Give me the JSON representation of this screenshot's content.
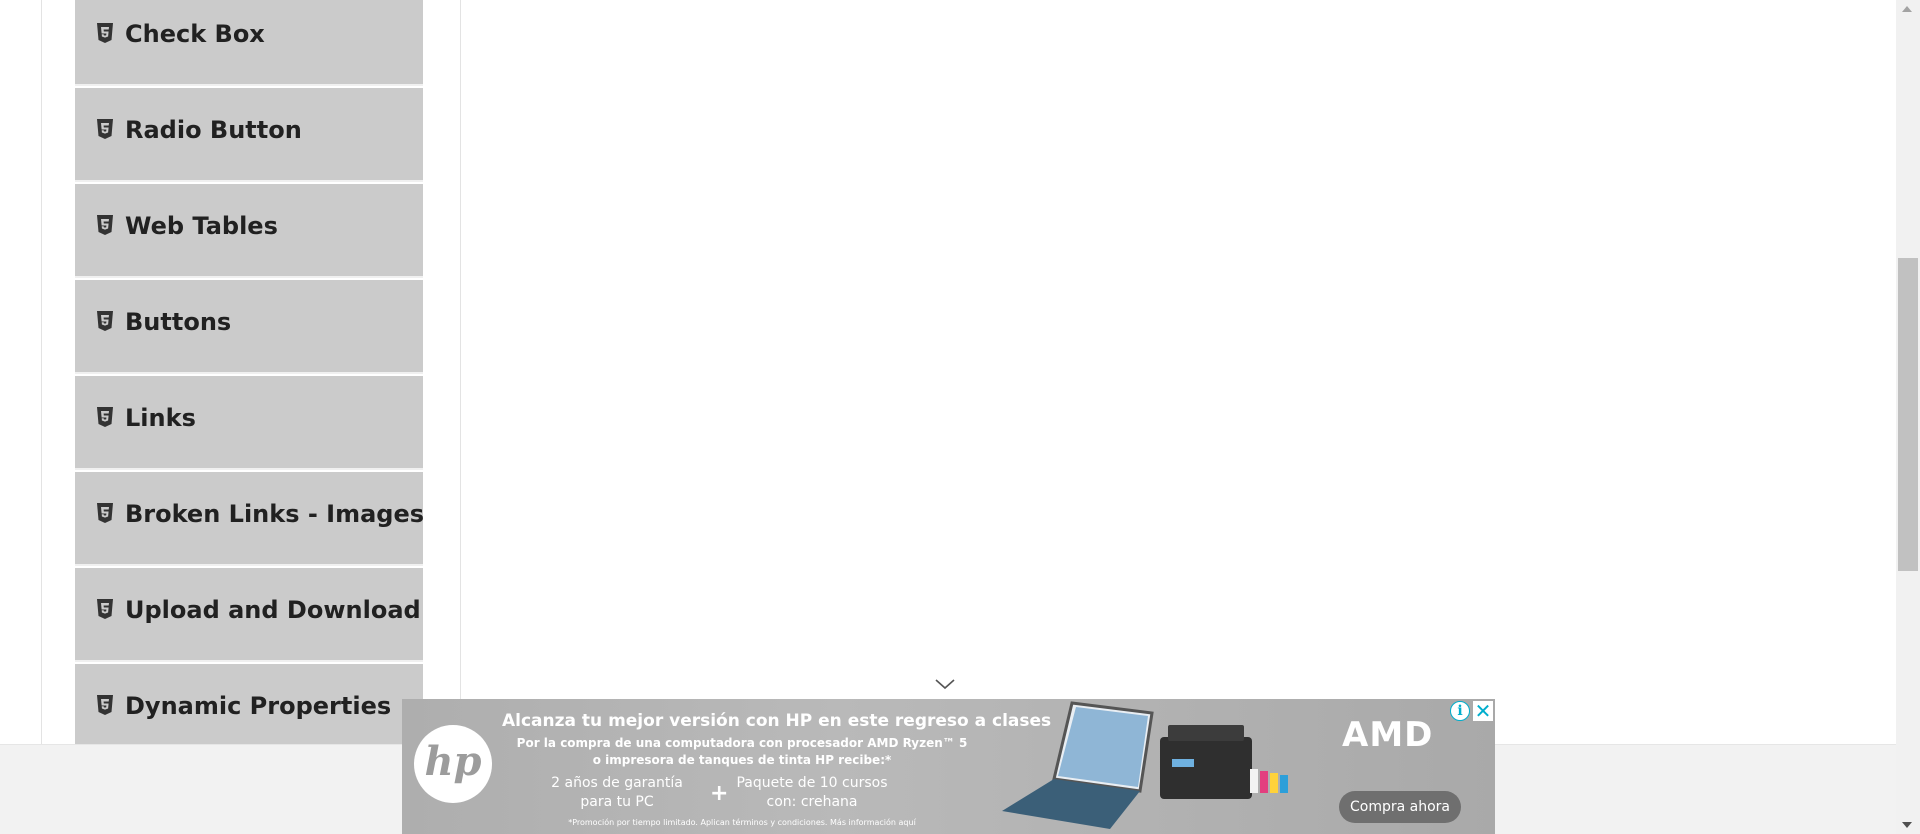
{
  "sidebar": {
    "items": [
      {
        "label": "Check Box"
      },
      {
        "label": "Radio Button"
      },
      {
        "label": "Web Tables"
      },
      {
        "label": "Buttons"
      },
      {
        "label": "Links"
      },
      {
        "label": "Broken Links - Images"
      },
      {
        "label": "Upload and Download"
      },
      {
        "label": "Dynamic Properties"
      }
    ]
  },
  "ad": {
    "headline": "Alcanza tu mejor versión con HP en este regreso a clases",
    "subline1": "Por la compra de una computadora con procesador AMD Ryzen™ 5",
    "subline2": "o impresora de tanques de tinta HP recibe:*",
    "warranty_line1": "2 años de garantía",
    "warranty_line2": "para tu PC",
    "plus": "+",
    "course_line1": "Paquete de 10 cursos",
    "course_line2": "con: crehana",
    "legal": "*Promoción por tiempo limitado. Aplican términos y condiciones. Más información aquí",
    "hp_logo": "hp",
    "brand": "AMD",
    "cta": "Compra ahora",
    "info_glyph": "i",
    "close_glyph": "✕"
  },
  "colors": {
    "menu_bg": "#cbcbcb",
    "menu_text": "#212121",
    "footer_bg": "#f2f2f2",
    "ad_accent": "#00aecd"
  }
}
